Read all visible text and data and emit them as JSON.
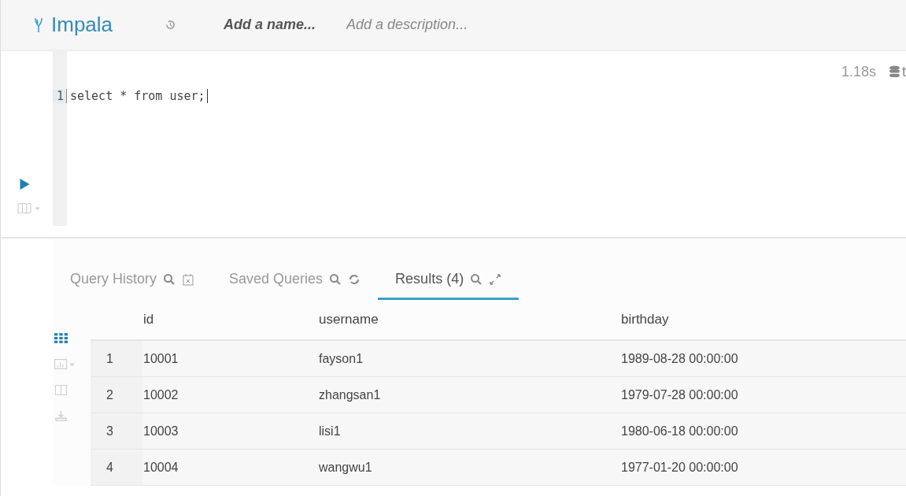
{
  "header": {
    "app_name": "Impala",
    "name_placeholder": "Add a name...",
    "description_placeholder": "Add a description..."
  },
  "editor": {
    "duration": "1.18s",
    "database_label": "t",
    "lines": [
      {
        "number": "1",
        "code": "select * from user;"
      }
    ]
  },
  "tabs": [
    {
      "label": "Query History",
      "selected": false,
      "kind": "history"
    },
    {
      "label": "Saved Queries",
      "selected": false,
      "kind": "saved"
    },
    {
      "label": "Results (4)",
      "selected": true,
      "kind": "results"
    }
  ],
  "view_modes": [
    {
      "kind": "grid",
      "selected": true
    },
    {
      "kind": "chart",
      "selected": false
    },
    {
      "kind": "columns",
      "selected": false
    },
    {
      "kind": "download",
      "selected": false
    }
  ],
  "table": {
    "columns": [
      "id",
      "username",
      "birthday"
    ],
    "rows": [
      {
        "index": "1",
        "cells": [
          "10001",
          "fayson1",
          "1989-08-28 00:00:00"
        ]
      },
      {
        "index": "2",
        "cells": [
          "10002",
          "zhangsan1",
          "1979-07-28 00:00:00"
        ]
      },
      {
        "index": "3",
        "cells": [
          "10003",
          "lisi1",
          "1980-06-18 00:00:00"
        ]
      },
      {
        "index": "4",
        "cells": [
          "10004",
          "wangwu1",
          "1977-01-20 00:00:00"
        ]
      }
    ]
  }
}
